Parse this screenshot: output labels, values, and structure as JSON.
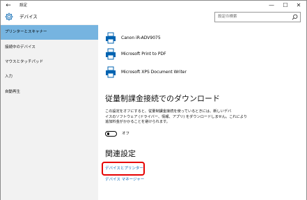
{
  "window": {
    "title": "設定",
    "back_glyph": "←",
    "minimize_glyph": "—",
    "maximize_glyph": "☐",
    "close_glyph": "✕"
  },
  "header": {
    "title": "デバイス",
    "icon": "gear-icon"
  },
  "search": {
    "placeholder": "設定の検索",
    "icon": "search-icon"
  },
  "sidebar": {
    "items": [
      {
        "label": "プリンターとスキャナー",
        "selected": true
      },
      {
        "label": "接続中のデバイス",
        "selected": false
      },
      {
        "label": "マウスとタッチパッド",
        "selected": false
      },
      {
        "label": "入力",
        "selected": false
      },
      {
        "label": "自動再生",
        "selected": false
      }
    ]
  },
  "printers": [
    {
      "name": "Canon iR-ADV9075",
      "icon": "printer-icon"
    },
    {
      "name": "Microsoft Print to PDF",
      "icon": "printer-icon"
    },
    {
      "name": "Microsoft XPS Document Writer",
      "icon": "printer-icon"
    }
  ],
  "metered": {
    "title": "従量制課金接続でのダウンロード",
    "description_line1": "この設定をオフにすると、従量制課金接続を使っているときには、新しいデバ",
    "description_line2": "イスのソフトウェア (ドライバー、情報、アプリ) をダウンロードしません。これにより",
    "description_line3": "追加料金がかかることを避けられます。",
    "toggle_label": "オフ",
    "toggle_on": false
  },
  "related": {
    "title": "関連設定",
    "devices_printers_link": "デバイスとプリンター",
    "device_manager_link": "デバイス マネージャー"
  },
  "colors": {
    "selected_nav": "#76b4e0",
    "link": "#0063b1",
    "highlight": "#e60000",
    "sidebar_bg": "#f2f2f2"
  }
}
